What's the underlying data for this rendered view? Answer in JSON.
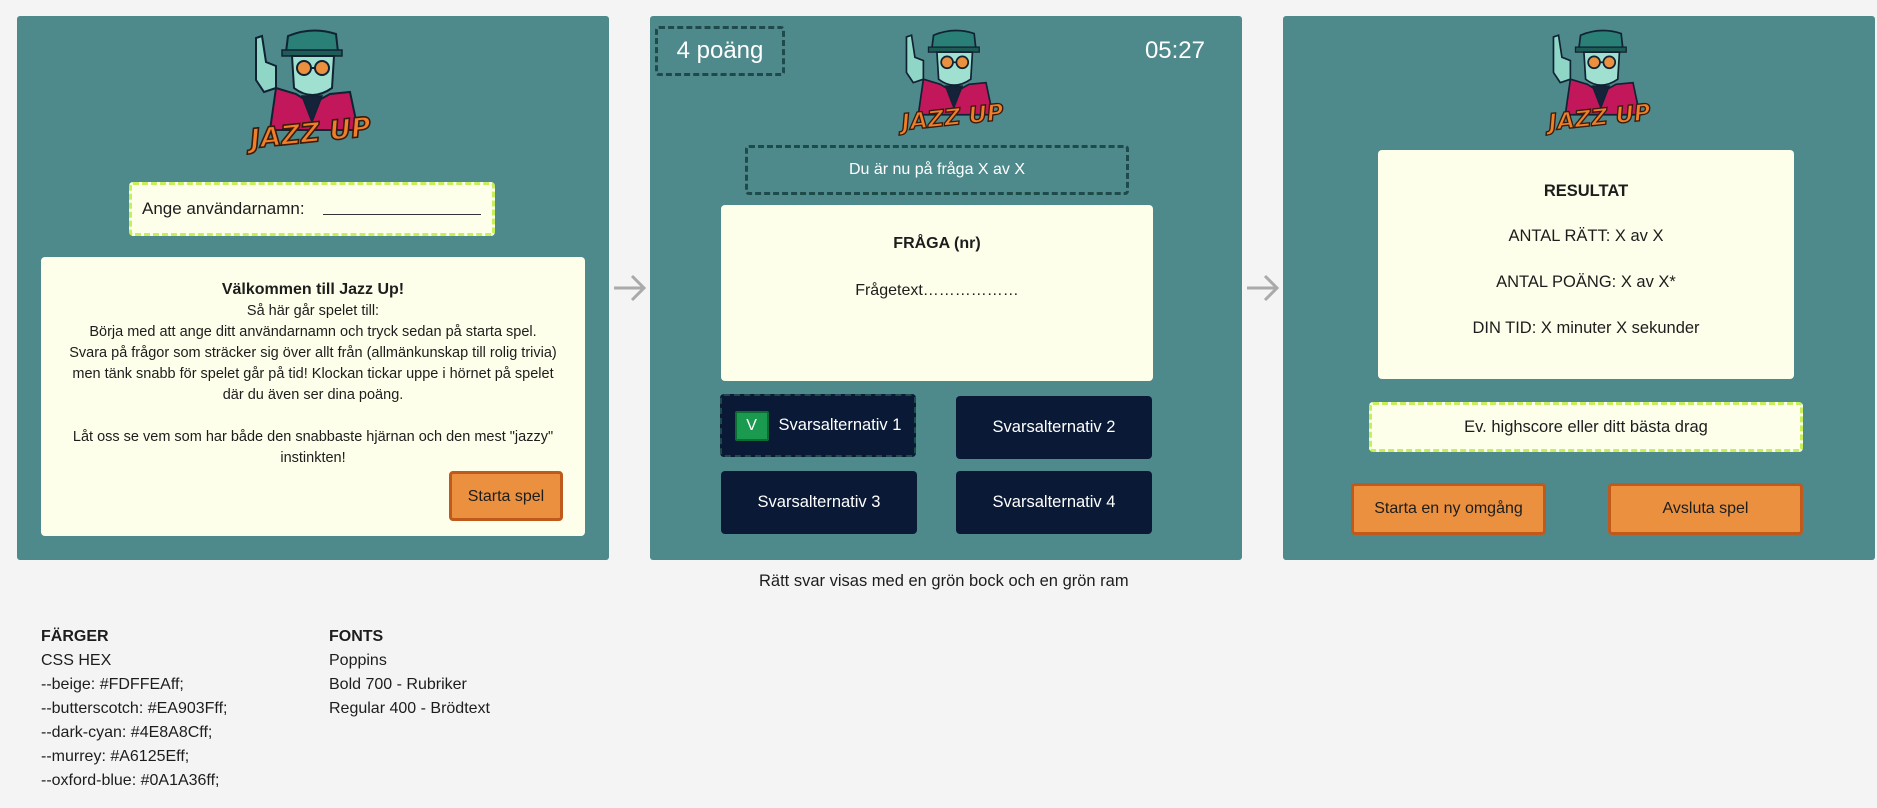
{
  "logo_text": "JAZZ UP",
  "panel1": {
    "username_label": "Ange användarnamn:",
    "welcome_title": "Välkommen till Jazz Up!",
    "welcome_lines": [
      "Så här går spelet till:",
      "Börja med att ange ditt användarnamn och tryck sedan på starta spel.",
      "Svara på frågor som sträcker sig över allt från (allmänkunskap till rolig trivia)",
      "men tänk snabb för spelet går på tid! Klockan tickar uppe i hörnet på spelet",
      "där du även ser dina poäng."
    ],
    "welcome_outro_1": "Låt oss se vem som har både den snabbaste hjärnan och den mest \"jazzy\"",
    "welcome_outro_2": "instinkten!",
    "start_button": "Starta spel"
  },
  "panel2": {
    "score": "4 poäng",
    "timer": "05:27",
    "progress": "Du är nu på fråga X av X",
    "question_title": "FRÅGA (nr)",
    "question_text": "Frågetext………………",
    "correct_mark": "V",
    "answers": [
      "Svarsalternativ 1",
      "Svarsalternativ 2",
      "Svarsalternativ 3",
      "Svarsalternativ 4"
    ]
  },
  "panel3": {
    "result_title": "RESULTAT",
    "correct_count": "ANTAL RÄTT: X av X",
    "points": "ANTAL POÄNG: X av X*",
    "time": "DIN TID: X minuter X sekunder",
    "highscore": "Ev. highscore eller ditt bästa drag",
    "new_round_button": "Starta en ny omgång",
    "quit_button": "Avsluta spel"
  },
  "caption": "Rätt svar visas med en grön bock och en grön ram",
  "colors": {
    "heading": "FÄRGER",
    "subheading": "CSS HEX",
    "lines": [
      "--beige: #FDFFEAff;",
      "--butterscotch: #EA903Fff;",
      "--dark-cyan: #4E8A8Cff;",
      "--murrey: #A6125Eff;",
      "--oxford-blue: #0A1A36ff;"
    ]
  },
  "fonts": {
    "heading": "FONTS",
    "lines": [
      "Poppins",
      "Bold 700 - Rubriker",
      "Regular 400 - Brödtext"
    ]
  }
}
